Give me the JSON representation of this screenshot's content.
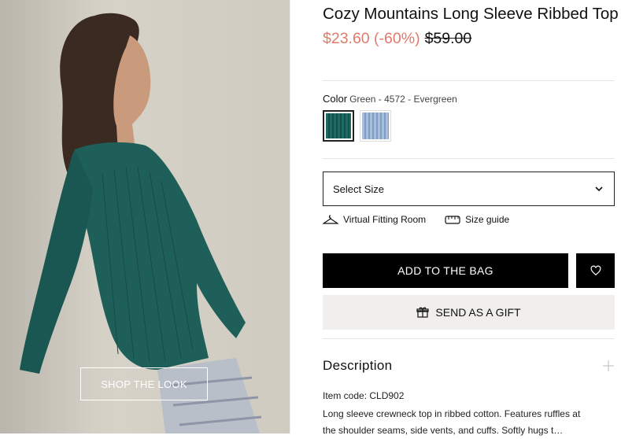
{
  "photo": {
    "shop_the_look_label": "SHOP THE LOOK"
  },
  "product": {
    "title": "Cozy Mountains Long Sleeve Ribbed Top",
    "price_sale": "$23.60 (-60%)",
    "price_original": "$59.00",
    "color_label": "Color",
    "color_value": "Green - 4572 - Evergreen",
    "swatches": [
      {
        "name": "Evergreen",
        "color": "#1f6b64",
        "selected": true
      },
      {
        "name": "Light Blue",
        "color": "#a8bfdc",
        "selected": false
      }
    ],
    "size_placeholder": "Select Size",
    "links": {
      "virtual_fitting": "Virtual Fitting Room",
      "size_guide": "Size guide"
    },
    "add_to_bag_label": "ADD TO THE BAG",
    "send_gift_label": "SEND AS A GIFT",
    "description_heading": "Description",
    "item_code": "Item code: CLD902",
    "description_text": "Long sleeve crewneck top in ribbed cotton. Features ruffles at the shoulder seams, side vents, and cuffs. Softly hugs t…"
  },
  "colors": {
    "sale_price": "#e07a6a",
    "primary_button": "#000000",
    "gift_button_bg": "#f0efed"
  }
}
